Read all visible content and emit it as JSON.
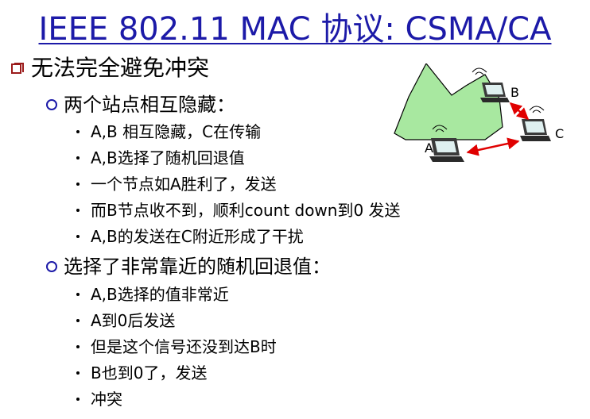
{
  "slide": {
    "title": "IEEE 802.11 MAC 协议: CSMA/CA",
    "point": "无法完全避免冲突",
    "sections": [
      {
        "heading": "两个站点相互隐藏：",
        "items": [
          "A,B 相互隐藏，C在传输",
          "A,B选择了随机回退值",
          "一个节点如A胜利了，发送",
          "而B节点收不到，顺利count down到0 发送",
          "A,B的发送在C附近形成了干扰"
        ]
      },
      {
        "heading": "选择了非常靠近的随机回退值：",
        "items": [
          "A,B选择的值非常近",
          "A到0后发送",
          "但是这个信号还没到达B时",
          "B也到0了，发送",
          "冲突"
        ]
      }
    ]
  },
  "illustration": {
    "station_labels": {
      "a": "A",
      "b": "B",
      "c": "C"
    },
    "colors": {
      "mountain": "#a8e8a0",
      "arrow": "#e00000",
      "laptop": "#3a3a3a"
    }
  }
}
